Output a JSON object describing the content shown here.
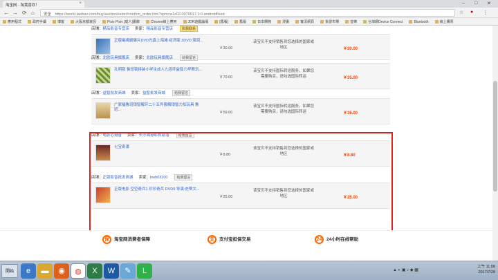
{
  "browser": {
    "tab_title": "淘宝网 - 淘我喜欢！",
    "tab_close": "×",
    "security": "安全",
    "url": "https://world.taobao.com/buy/auction/order/confirm_order.htm?spm=a1z02.0076517.0.0.androidfixed",
    "bookmarks": [
      "應用程式",
      "政府手續",
      "博客",
      "大阪京都資訊",
      "Pixiv Pixiv [成人]畫廊",
      "Chrome線上應用",
      "JDR遊戲論壇",
      "[舊版]",
      "舊版",
      "日本購物",
      "漫畫",
      "實況網頁",
      "批發市場",
      "音樂",
      "台灣網Device Connect",
      "Bluetooth",
      "線上購票"
    ]
  },
  "groups": [
    {
      "shop_label": "店铺：",
      "shop": "精品影音专营店",
      "seller_label": "卖家：",
      "seller": "精品影音专营店",
      "badge": "和我联系",
      "badge_style": "gold",
      "thumb": "t1",
      "title": "正版電視劇碟片DVD光盘上海滩 经济版 3DVD 周润...",
      "price": "￥30.00",
      "msg": "该宝贝不支持销售到您选择的国家或地区",
      "subtotal": "￥30.00"
    },
    {
      "shop_label": "店铺：",
      "shop": "北欧玩具旗舰店",
      "seller_label": "卖家：",
      "seller": "北欧玩具旗舰店",
      "badge": "给我留言",
      "badge_style": "gray",
      "thumb": "t2",
      "title": "孔明锁 鲁班锁拼装小学生成人九连环益智力早教玩...",
      "price": "￥70.00",
      "msg": "该宝贝不支持国际转运服务，如果您需要购买，请勾选国际转运",
      "subtotal": "￥35.00"
    },
    {
      "shop_label": "店铺：",
      "shop": "益智批发商城",
      "seller_label": "卖家：",
      "seller": "益智批发商城",
      "badge": "给我留言",
      "badge_style": "gray",
      "thumb": "t3",
      "title": "广家福鲁班锁智解环二十五件套解锁智力扣玩具 鲁班...",
      "price": "￥59.00",
      "msg": "该宝贝不支持国际转运服务，如果您需要购买，请勾选国际转运",
      "subtotal": "￥35.00"
    },
    {
      "shop_label": "店铺：",
      "shop": "电影心港音",
      "seller_label": "卖家：",
      "seller": "长沙湘港影视部落",
      "badge": "给我留言",
      "badge_style": "gray",
      "thumb": "t4",
      "title": "七宝奇谋",
      "price": "￥8.80",
      "msg": "该宝贝不支持销售到您选择的国家或地区",
      "subtotal": "￥8.80"
    },
    {
      "shop_label": "店铺：",
      "shop": "正版影音批发商城",
      "seller_label": "卖家：",
      "seller": "bwh03200",
      "badge": "给我留言",
      "badge_style": "gray",
      "thumb": "t5",
      "title": "正版电影 空空奇兵1 珍珍奇兵 DVD9 导演:史蒂文...",
      "price": "￥25.00",
      "msg": "该宝贝不支持销售到您选择的国家或地区",
      "subtotal": "￥25.00"
    }
  ],
  "guarantees": [
    "淘宝网消费者保障",
    "支付宝担保交易",
    "24小时在线帮助"
  ],
  "taskbar": {
    "start": "開始",
    "time": "上午 11:08",
    "date": "2017/7/28"
  }
}
